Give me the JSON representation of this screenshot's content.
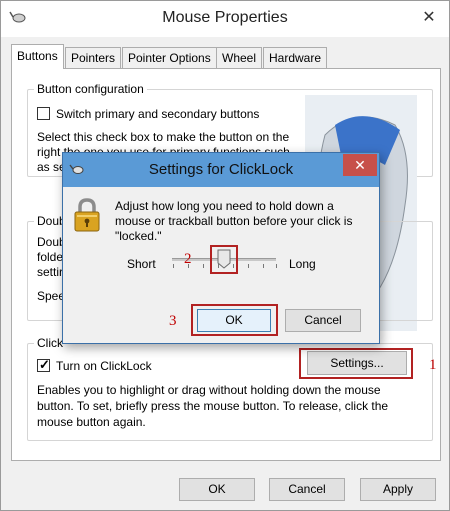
{
  "window": {
    "title": "Mouse Properties",
    "close_glyph": "✕"
  },
  "tabs": [
    "Buttons",
    "Pointers",
    "Pointer Options",
    "Wheel",
    "Hardware"
  ],
  "button_config": {
    "group_label": "Button configuration",
    "checkbox_label": "Switch primary and secondary buttons",
    "description_lines": [
      "Select this check box to make the button on the",
      "right the one you use for primary functions such",
      "as se"
    ]
  },
  "double_click": {
    "group_label_partial": "Doub",
    "lines_partial": [
      "Doub",
      "folde",
      "settir"
    ],
    "speed_partial": "Spee"
  },
  "clicklock": {
    "group_label_partial": "Click",
    "checkbox_label": "Turn on ClickLock",
    "checked": true,
    "settings_button": "Settings...",
    "description_lines": [
      "Enables you to highlight or drag without holding down the mouse",
      "button. To set, briefly press the mouse button. To release, click the",
      "mouse button again."
    ]
  },
  "footer": {
    "ok": "OK",
    "cancel": "Cancel",
    "apply": "Apply"
  },
  "dialog": {
    "title": "Settings for ClickLock",
    "close_glyph": "✕",
    "message_lines": [
      "Adjust how long you need to hold down a",
      "mouse or trackball button before your click is",
      "\"locked.\""
    ],
    "slider_min_label": "Short",
    "slider_max_label": "Long",
    "slider_value_fraction": 0.45,
    "ok": "OK",
    "cancel": "Cancel"
  },
  "annotations": {
    "n1": "1",
    "n2": "2",
    "n3": "3",
    "color": "#c00000"
  },
  "colors": {
    "dialog_titlebar": "#5a9ad6",
    "close_red": "#c7504a",
    "annotation_red": "#b22222"
  }
}
